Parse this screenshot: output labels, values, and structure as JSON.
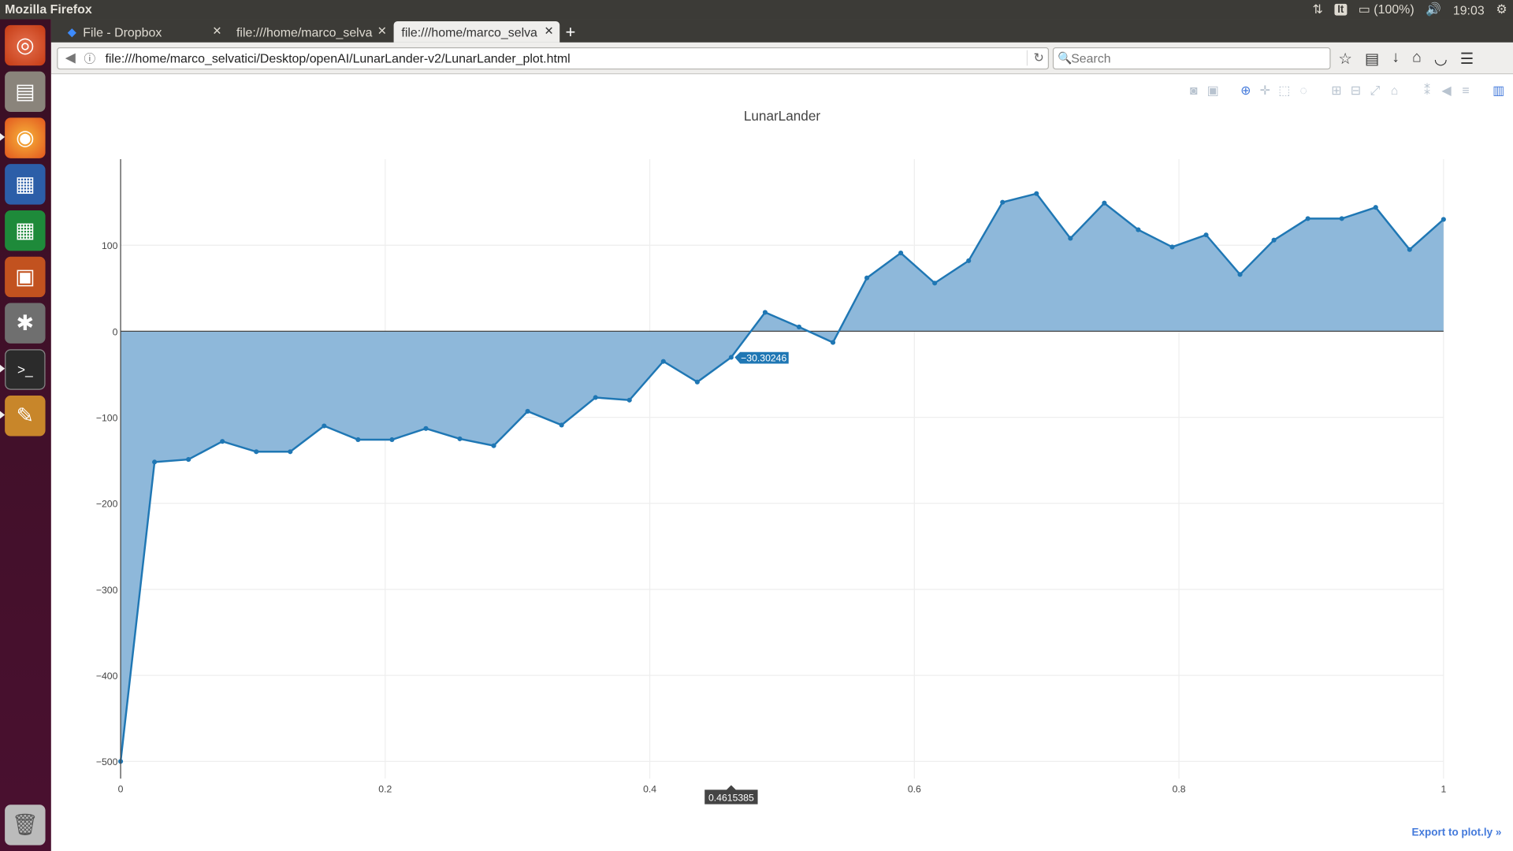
{
  "system": {
    "window_title": "Mozilla Firefox",
    "keyboard_layout": "It",
    "battery": "(100%)",
    "clock": "19:03"
  },
  "browser": {
    "tabs": [
      {
        "label": "File - Dropbox",
        "icon": "dropbox-icon",
        "active": false
      },
      {
        "label": "file:///home/marco_selva",
        "active": false
      },
      {
        "label": "file:///home/marco_selva",
        "active": true
      }
    ],
    "url": "file:///home/marco_selvatici/Desktop/openAI/LunarLander-v2/LunarLander_plot.html",
    "search_placeholder": "Search"
  },
  "launcher": {
    "apps": [
      "ubuntu-dash-icon",
      "files-icon",
      "firefox-icon",
      "writer-icon",
      "calc-icon",
      "impress-icon",
      "system-settings-icon",
      "terminal-icon",
      "text-editor-icon",
      "trash-icon"
    ]
  },
  "plot": {
    "export_link": "Export to plot.ly »",
    "hover_y": "−30.30246",
    "hover_x": "0.4615385",
    "fill_color": "#8eb8da",
    "line_color": "#1f77b4"
  },
  "chart_data": {
    "type": "area",
    "title": "LunarLander",
    "xlabel": "",
    "ylabel": "",
    "xlim": [
      0,
      1
    ],
    "ylim": [
      -520,
      200
    ],
    "xticks": [
      0,
      0.2,
      0.4,
      0.6,
      0.8,
      1
    ],
    "xtick_labels": [
      "0",
      "0.2",
      "0.4",
      "0.6",
      "0.8",
      "1"
    ],
    "yticks": [
      -500,
      -400,
      -300,
      -200,
      -100,
      0,
      100
    ],
    "ytick_labels": [
      "−500",
      "−400",
      "−300",
      "−200",
      "−100",
      "0",
      "100"
    ],
    "grid": true,
    "x": [
      0,
      0.025641,
      0.051282,
      0.076923,
      0.102564,
      0.128205,
      0.153846,
      0.179487,
      0.205128,
      0.230769,
      0.25641,
      0.282051,
      0.307692,
      0.333333,
      0.358974,
      0.384615,
      0.410256,
      0.435897,
      0.461538,
      0.487179,
      0.512821,
      0.538462,
      0.564103,
      0.589744,
      0.615385,
      0.641026,
      0.666667,
      0.692308,
      0.717949,
      0.74359,
      0.769231,
      0.794872,
      0.820513,
      0.846154,
      0.871795,
      0.897436,
      0.923077,
      0.948718,
      0.974359,
      1
    ],
    "series": [
      {
        "values": [
          -500,
          -152,
          -149,
          -128,
          -140,
          -140,
          -110,
          -126,
          -126,
          -113,
          -125,
          -133,
          -93,
          -109,
          -77,
          -80,
          -35,
          -59,
          -30.30246,
          22,
          5,
          -13,
          62,
          91,
          56,
          82,
          150,
          160,
          108,
          149,
          118,
          98,
          112,
          66,
          106,
          131,
          131,
          144,
          95,
          130
        ]
      }
    ]
  }
}
